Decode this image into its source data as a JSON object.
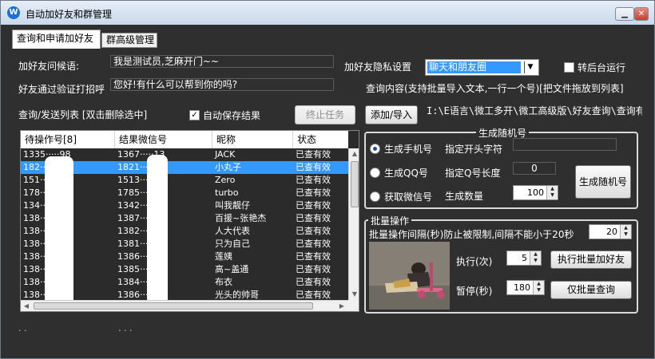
{
  "window": {
    "title": "自动加好友和群管理",
    "minimize_label": "▁",
    "close_label": "✕"
  },
  "tabs": [
    {
      "label": "查询和申请加好友"
    },
    {
      "label": "群高级管理"
    }
  ],
  "form": {
    "greeting_label": "加好友问候语:",
    "greeting_value": "我是测试员,芝麻开门~~",
    "verify_label": "好友通过验证打招呼",
    "verify_value": "您好!有什么可以帮到你的吗?",
    "privacy_label": "加好友隐私设置",
    "privacy_selected": "聊天和朋友圈",
    "background_label": "转后台运行",
    "background_checked": false,
    "query_hint": "查询内容(支持批量导入文本,一行一个号)[把文件拖放到列表]",
    "list_label": "查询/发送列表 [双击删除选中]",
    "autosave_label": "自动保存结果",
    "autosave_checked": true,
    "stop_label": "终止任务",
    "add_label": "添加/导入",
    "import_path": "I:\\E语言\\微工多开\\微工高级版\\好友查询\\查询有"
  },
  "list": {
    "columns": [
      "待操作号[8]",
      "结果微信号",
      "昵称",
      "状态"
    ],
    "rows": [
      {
        "op": "1335·····98",
        "wx": "1367·····13",
        "nick": "JACK",
        "status": "已查有效"
      },
      {
        "op": "182·····61",
        "wx": "1821·····51",
        "nick": "小丸子",
        "status": "已查有效",
        "selected": true
      },
      {
        "op": "151·····12",
        "wx": "1513·····12",
        "nick": "Zero",
        "status": "已查有效"
      },
      {
        "op": "178·····30",
        "wx": "1785·····30",
        "nick": "turbo",
        "status": "已查有效"
      },
      {
        "op": "134·····39",
        "wx": "1342·····39",
        "nick": "叫我靓仔",
        "status": "已查有效"
      },
      {
        "op": "138·····13",
        "wx": "1387·····13",
        "nick": "百援~张艳杰",
        "status": "已查有效"
      },
      {
        "op": "138·····60",
        "wx": "1382·····60",
        "nick": "人大代表",
        "status": "已查有效"
      },
      {
        "op": "138·····78",
        "wx": "1381·····78",
        "nick": "只为自己",
        "status": "已查有效"
      },
      {
        "op": "138·····37",
        "wx": "1386·····37",
        "nick": "莲姨",
        "status": "已查有效"
      },
      {
        "op": "138·····01",
        "wx": "1385·····01",
        "nick": "高~盖通",
        "status": "已查有效"
      },
      {
        "op": "138·····16",
        "wx": "1384·····16",
        "nick": "布衣",
        "status": "已查有效"
      },
      {
        "op": "138·····54",
        "wx": "1386·····54",
        "nick": "光头的帅哥",
        "status": "已查有效"
      }
    ]
  },
  "random": {
    "title": "生成随机号",
    "phone_label": "生成手机号",
    "qq_label": "生成QQ号",
    "wechat_label": "获取微信号",
    "selected_option": "phone",
    "prefix_label": "指定开头字符",
    "prefix_value": "",
    "qq_len_label": "指定Q号长度",
    "qq_len_value": "0",
    "count_label": "生成数量",
    "count_value": "100",
    "generate_label": "生成随机号"
  },
  "batch": {
    "title": "批量操作",
    "interval_label": "批量操作间隔(秒)防止被限制,间隔不能小于20秒",
    "interval_value": "20",
    "exec_label": "执行(次)",
    "exec_value": "5",
    "pause_label": "暂停(秒)",
    "pause_value": "180",
    "batch_add_label": "执行批量加好友",
    "batch_query_label": "仅批量查询"
  },
  "status": {
    "left": ". .",
    "mid": ". . ."
  },
  "colors": {
    "window_bg": "#2f2f2f",
    "selection": "#3399ff",
    "title_gradient_top": "#e6eef8"
  }
}
